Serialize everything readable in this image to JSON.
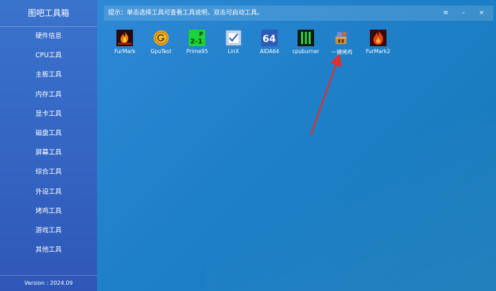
{
  "app": {
    "title": "图吧工具箱",
    "version": "Version : 2024.09"
  },
  "sidebar": {
    "items": [
      {
        "label": "硬件信息"
      },
      {
        "label": "CPU工具"
      },
      {
        "label": "主板工具"
      },
      {
        "label": "内存工具"
      },
      {
        "label": "显卡工具"
      },
      {
        "label": "磁盘工具"
      },
      {
        "label": "屏幕工具"
      },
      {
        "label": "综合工具"
      },
      {
        "label": "外设工具"
      },
      {
        "label": "烤鸡工具"
      },
      {
        "label": "游戏工具"
      },
      {
        "label": "其他工具"
      }
    ]
  },
  "tipbar": {
    "text": "提示：单击选择工具可查看工具说明，双击可启动工具。",
    "menu_glyph": "≡",
    "minimize_glyph": "-",
    "close_glyph": "×"
  },
  "tools": [
    {
      "label": "FurMark",
      "icon": "furmark-icon"
    },
    {
      "label": "GpuTest",
      "icon": "gputest-icon"
    },
    {
      "label": "Prime95",
      "icon": "prime95-icon"
    },
    {
      "label": "LinX",
      "icon": "linx-icon"
    },
    {
      "label": "AIDA64",
      "icon": "aida64-icon"
    },
    {
      "label": "cpuburner",
      "icon": "cpuburner-icon"
    },
    {
      "label": "一键烤鸡",
      "icon": "one-click-stress-icon"
    },
    {
      "label": "FurMark2",
      "icon": "furmark2-icon"
    }
  ],
  "icon_text": {
    "aida64": "64",
    "prime95_top": "P",
    "prime95_bottom": "2-1"
  },
  "colors": {
    "sidebar": "#3466c4",
    "main": "#1f80c8",
    "annotation_arrow": "#e0302a"
  }
}
